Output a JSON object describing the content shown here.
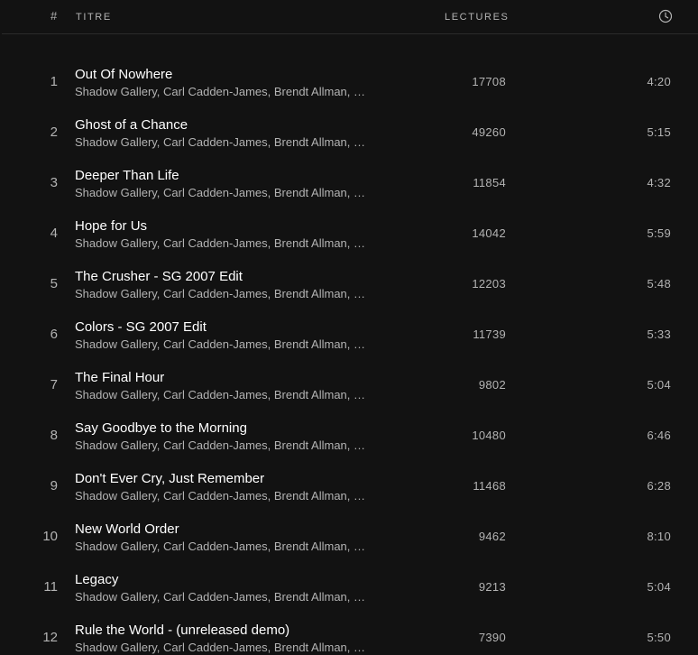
{
  "header": {
    "number_label": "#",
    "title_label": "TITRE",
    "plays_label": "LECTURES",
    "duration_icon": "clock-icon"
  },
  "tracks": [
    {
      "number": "1",
      "title": "Out Of Nowhere",
      "artists": "Shadow Gallery, Carl Cadden-James, Brendt Allman, …",
      "plays": "17708",
      "duration": "4:20"
    },
    {
      "number": "2",
      "title": "Ghost of a Chance",
      "artists": "Shadow Gallery, Carl Cadden-James, Brendt Allman, …",
      "plays": "49260",
      "duration": "5:15"
    },
    {
      "number": "3",
      "title": "Deeper Than Life",
      "artists": "Shadow Gallery, Carl Cadden-James, Brendt Allman, …",
      "plays": "11854",
      "duration": "4:32"
    },
    {
      "number": "4",
      "title": "Hope for Us",
      "artists": "Shadow Gallery, Carl Cadden-James, Brendt Allman, …",
      "plays": "14042",
      "duration": "5:59"
    },
    {
      "number": "5",
      "title": "The Crusher - SG 2007 Edit",
      "artists": "Shadow Gallery, Carl Cadden-James, Brendt Allman, …",
      "plays": "12203",
      "duration": "5:48"
    },
    {
      "number": "6",
      "title": "Colors - SG 2007 Edit",
      "artists": "Shadow Gallery, Carl Cadden-James, Brendt Allman, …",
      "plays": "11739",
      "duration": "5:33"
    },
    {
      "number": "7",
      "title": "The Final Hour",
      "artists": "Shadow Gallery, Carl Cadden-James, Brendt Allman, …",
      "plays": "9802",
      "duration": "5:04"
    },
    {
      "number": "8",
      "title": "Say Goodbye to the Morning",
      "artists": "Shadow Gallery, Carl Cadden-James, Brendt Allman, …",
      "plays": "10480",
      "duration": "6:46"
    },
    {
      "number": "9",
      "title": "Don't Ever Cry, Just Remember",
      "artists": "Shadow Gallery, Carl Cadden-James, Brendt Allman, …",
      "plays": "11468",
      "duration": "6:28"
    },
    {
      "number": "10",
      "title": "New World Order",
      "artists": "Shadow Gallery, Carl Cadden-James, Brendt Allman, …",
      "plays": "9462",
      "duration": "8:10"
    },
    {
      "number": "11",
      "title": "Legacy",
      "artists": "Shadow Gallery, Carl Cadden-James, Brendt Allman, …",
      "plays": "9213",
      "duration": "5:04"
    },
    {
      "number": "12",
      "title": "Rule the World - (unreleased demo)",
      "artists": "Shadow Gallery, Carl Cadden-James, Brendt Allman, …",
      "plays": "7390",
      "duration": "5:50"
    }
  ],
  "colors": {
    "background": "#121212",
    "primary_text": "#ffffff",
    "secondary_text": "#b3b3b3",
    "divider": "#2a2a2a"
  }
}
